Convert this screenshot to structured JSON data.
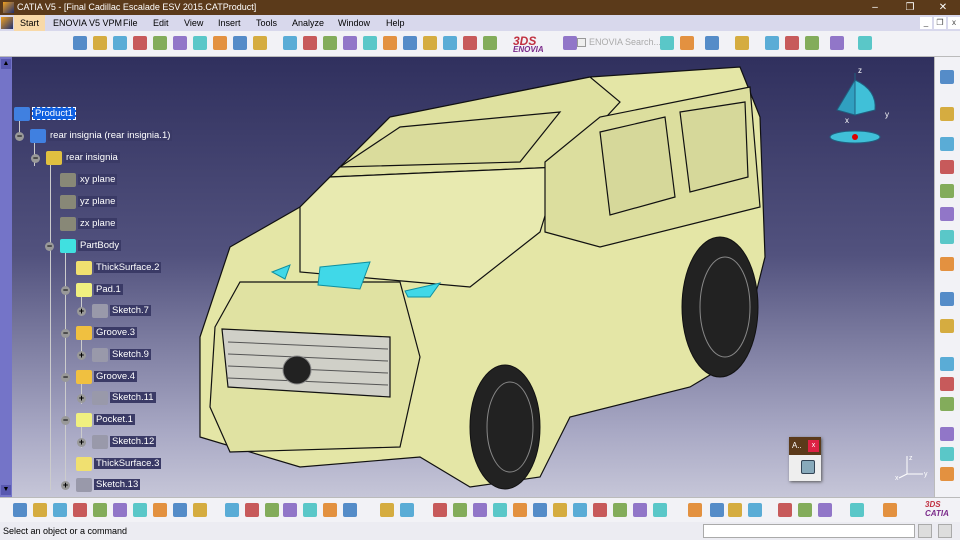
{
  "window": {
    "title": "CATIA V5 - [Final Cadillac Escalade ESV 2015.CATProduct]",
    "minimize": "–",
    "maximize": "❐",
    "close": "✕"
  },
  "menu": {
    "start": "Start",
    "items": [
      "ENOVIA V5 VPM",
      "File",
      "Edit",
      "View",
      "Insert",
      "Tools",
      "Analyze",
      "Window",
      "Help"
    ],
    "doc_minimize": "_",
    "doc_restore": "❐",
    "doc_close": "x"
  },
  "toolbar": {
    "enovia_search": "ENOVIA Search...",
    "enovia_logo": "ENOVIA"
  },
  "tree": [
    {
      "label": "Product1",
      "selected": true
    },
    {
      "label": "rear insignia (rear insignia.1)"
    },
    {
      "label": "rear insignia"
    },
    {
      "label": "xy plane"
    },
    {
      "label": "yz plane"
    },
    {
      "label": "zx plane"
    },
    {
      "label": "PartBody"
    },
    {
      "label": "ThickSurface.2"
    },
    {
      "label": "Pad.1"
    },
    {
      "label": "Sketch.7"
    },
    {
      "label": "Groove.3"
    },
    {
      "label": "Sketch.9"
    },
    {
      "label": "Groove.4"
    },
    {
      "label": "Sketch.11"
    },
    {
      "label": "Pocket.1"
    },
    {
      "label": "Sketch.12"
    },
    {
      "label": "ThickSurface.3"
    },
    {
      "label": "Sketch.13"
    }
  ],
  "compass": {
    "x": "x",
    "y": "y",
    "z": "z"
  },
  "axis_triad": {
    "x": "x",
    "y": "y",
    "z": "z"
  },
  "mini_toolbar": {
    "title": "A..",
    "close": "x"
  },
  "bottom_toolbar": {
    "catia_logo": "CATIA"
  },
  "status": {
    "message": "Select an object or a command",
    "command_input": ""
  },
  "colors": {
    "titlebar": "#5b3a1a",
    "menubar": "#d8d8ec",
    "car_body": "#e4e6a6",
    "glass_accent": "#40d8e8",
    "selection": "#1060e0"
  }
}
